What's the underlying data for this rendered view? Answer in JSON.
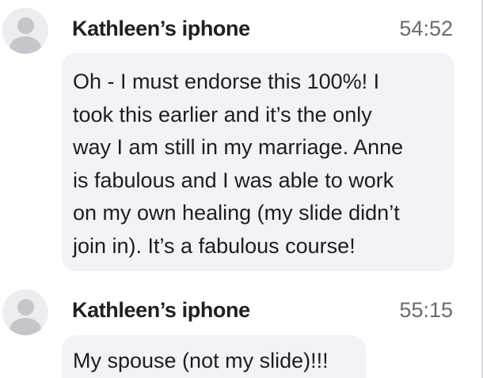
{
  "messages": [
    {
      "sender": "Kathleen’s iphone",
      "time": "54:52",
      "lines": [
        "Oh - I must endorse this 100%! I",
        "took this earlier and it’s the only",
        "way I am still in my marriage. Anne",
        "is fabulous and I was able to work",
        "on my own healing (my slide didn’t",
        "join in). It’s a fabulous course!"
      ]
    },
    {
      "sender": "Kathleen’s iphone",
      "time": "55:15",
      "lines": [
        "My spouse (not my slide)!!!"
      ]
    }
  ],
  "colors": {
    "bubble_background": "#f2f2f7",
    "avatar_background": "#ecedf1",
    "avatar_silhouette": "#c4c6cc",
    "sender_text": "#1f1f24",
    "time_text": "#6a6a72"
  },
  "icons": {
    "avatar": "default-user-avatar-icon"
  }
}
